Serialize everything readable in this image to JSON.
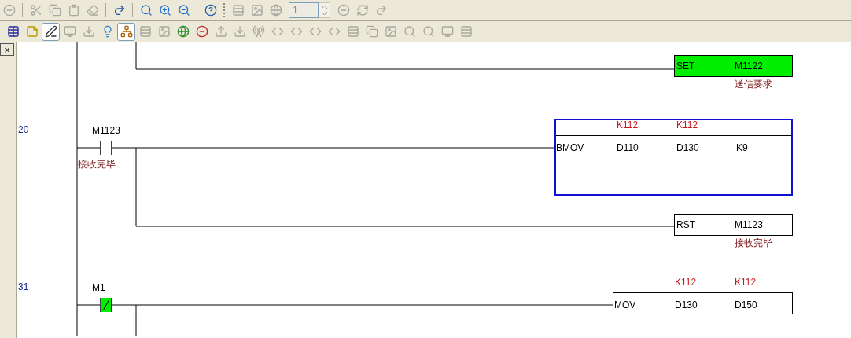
{
  "toolbar_1": [
    {
      "kind": "stop",
      "disabled": true
    },
    {
      "kind": "cut",
      "disabled": true
    },
    {
      "kind": "copy",
      "disabled": true
    },
    {
      "kind": "paste",
      "disabled": true
    },
    {
      "kind": "eraser",
      "disabled": true
    },
    {
      "kind": "redo",
      "disabled": false
    },
    {
      "kind": "search",
      "disabled": false
    },
    {
      "kind": "zoom-in",
      "disabled": false
    },
    {
      "kind": "zoom-out",
      "disabled": false
    },
    {
      "kind": "help",
      "disabled": false
    },
    {
      "kind": "rows",
      "disabled": true
    },
    {
      "kind": "image",
      "disabled": true
    },
    {
      "kind": "globe",
      "disabled": true
    },
    {
      "kind": "page-field",
      "value": "1",
      "disabled": true
    },
    {
      "kind": "stop",
      "disabled": true
    },
    {
      "kind": "refresh",
      "disabled": true
    },
    {
      "kind": "redo",
      "disabled": true
    }
  ],
  "toolbar_2": [
    {
      "kind": "table",
      "pressed": false,
      "disabled": false
    },
    {
      "kind": "note",
      "pressed": false,
      "disabled": false
    },
    {
      "kind": "pen",
      "pressed": true,
      "disabled": false
    },
    {
      "kind": "monitor",
      "pressed": false,
      "disabled": true
    },
    {
      "kind": "download",
      "pressed": false,
      "disabled": true
    },
    {
      "kind": "bulb",
      "pressed": false,
      "disabled": false
    },
    {
      "kind": "ladder",
      "pressed": true,
      "disabled": false
    },
    {
      "kind": "rows",
      "pressed": false,
      "disabled": true
    },
    {
      "kind": "image",
      "pressed": false,
      "disabled": true
    },
    {
      "kind": "globe",
      "pressed": false,
      "disabled": false
    },
    {
      "kind": "stop",
      "pressed": false,
      "disabled": false
    },
    {
      "kind": "upload",
      "pressed": false,
      "disabled": true
    },
    {
      "kind": "download",
      "pressed": false,
      "disabled": true
    },
    {
      "kind": "antenna",
      "pressed": false,
      "disabled": true
    },
    {
      "kind": "code",
      "pressed": false,
      "disabled": true
    },
    {
      "kind": "code",
      "pressed": false,
      "disabled": true
    },
    {
      "kind": "code",
      "pressed": false,
      "disabled": true
    },
    {
      "kind": "code",
      "pressed": false,
      "disabled": true
    },
    {
      "kind": "rows",
      "pressed": false,
      "disabled": true
    },
    {
      "kind": "copy",
      "pressed": false,
      "disabled": true
    },
    {
      "kind": "image",
      "pressed": false,
      "disabled": true
    },
    {
      "kind": "search",
      "pressed": false,
      "disabled": true
    },
    {
      "kind": "search",
      "pressed": false,
      "disabled": true
    },
    {
      "kind": "monitor",
      "pressed": false,
      "disabled": true
    },
    {
      "kind": "rows",
      "pressed": false,
      "disabled": true
    }
  ],
  "side_panel": {
    "close": "×"
  },
  "rungs": [
    {
      "output": {
        "kind": "coil",
        "op": "SET",
        "operand": "M1122",
        "comment": "送信要求",
        "active": true
      }
    },
    {
      "number": "20",
      "contact": {
        "label": "M1123",
        "comment": "接收完毕",
        "normally_closed": false,
        "active": false
      },
      "block": {
        "op": "BMOV",
        "args": [
          "D110",
          "D130",
          "K9"
        ],
        "values": [
          "K112",
          "K112"
        ],
        "selected": true
      },
      "output": {
        "kind": "coil",
        "op": "RST",
        "operand": "M1123",
        "comment": "接收完毕",
        "active": false
      }
    },
    {
      "number": "31",
      "contact": {
        "label": "M1",
        "normally_closed": true,
        "active": true
      },
      "block": {
        "op": "MOV",
        "args": [
          "D130",
          "D150"
        ],
        "values": [
          "K112",
          "K112"
        ],
        "selected": false
      }
    }
  ]
}
